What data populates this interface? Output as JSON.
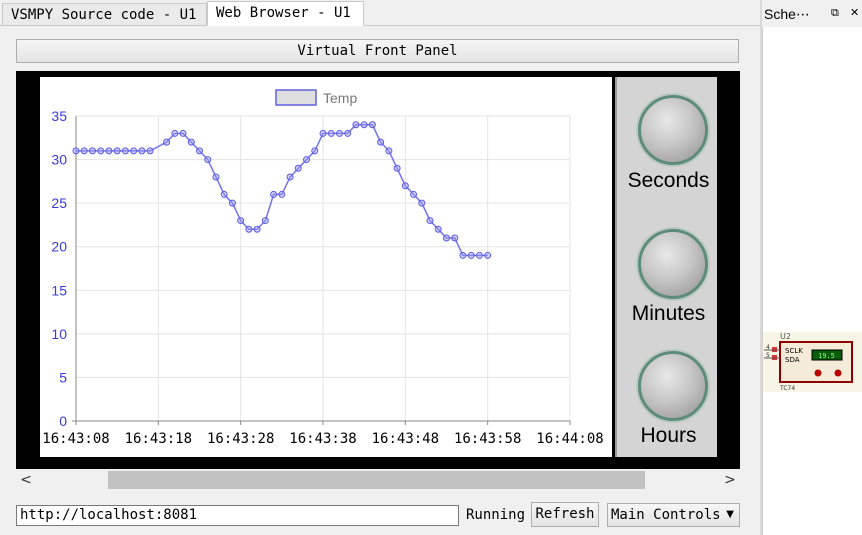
{
  "tabs": [
    {
      "label": "VSMPY Source code - U1",
      "active": false
    },
    {
      "label": "Web Browser - U1",
      "active": true
    }
  ],
  "panel_button_label": "Virtual Front Panel",
  "chart_data": {
    "type": "line",
    "legend": "Temp",
    "x": [
      "16:43:08",
      "16:43:09",
      "16:43:10",
      "16:43:11",
      "16:43:12",
      "16:43:13",
      "16:43:14",
      "16:43:15",
      "16:43:16",
      "16:43:17",
      "16:43:18",
      "16:43:19",
      "16:43:20",
      "16:43:21",
      "16:43:22",
      "16:43:23",
      "16:43:24",
      "16:43:25",
      "16:43:26",
      "16:43:27",
      "16:43:28",
      "16:43:29",
      "16:43:30",
      "16:43:31",
      "16:43:32",
      "16:43:33",
      "16:43:34",
      "16:43:35",
      "16:43:36",
      "16:43:37",
      "16:43:38",
      "16:43:39",
      "16:43:40",
      "16:43:41",
      "16:43:42",
      "16:43:43",
      "16:43:44",
      "16:43:45",
      "16:43:46",
      "16:43:47",
      "16:43:48",
      "16:43:49",
      "16:43:50",
      "16:43:51",
      "16:43:52",
      "16:43:53",
      "16:43:54",
      "16:43:55",
      "16:43:56",
      "16:43:57",
      "16:43:58",
      "16:43:59",
      "16:44:00",
      "16:44:01",
      "16:44:02",
      "16:44:03",
      "16:44:04",
      "16:44:05",
      "16:44:06",
      "16:44:07",
      "16:44:08"
    ],
    "series": [
      {
        "name": "Temp",
        "color": "#5b5be8",
        "points": [
          [
            "16:43:08",
            31
          ],
          [
            "16:43:09",
            31
          ],
          [
            "16:43:10",
            31
          ],
          [
            "16:43:11",
            31
          ],
          [
            "16:43:12",
            31
          ],
          [
            "16:43:13",
            31
          ],
          [
            "16:43:14",
            31
          ],
          [
            "16:43:15",
            31
          ],
          [
            "16:43:16",
            31
          ],
          [
            "16:43:17",
            31
          ],
          [
            "16:43:19",
            32
          ],
          [
            "16:43:20",
            33
          ],
          [
            "16:43:21",
            33
          ],
          [
            "16:43:22",
            32
          ],
          [
            "16:43:23",
            31
          ],
          [
            "16:43:24",
            30
          ],
          [
            "16:43:25",
            28
          ],
          [
            "16:43:26",
            26
          ],
          [
            "16:43:27",
            25
          ],
          [
            "16:43:28",
            23
          ],
          [
            "16:43:29",
            22
          ],
          [
            "16:43:30",
            22
          ],
          [
            "16:43:31",
            23
          ],
          [
            "16:43:32",
            26
          ],
          [
            "16:43:33",
            26
          ],
          [
            "16:43:34",
            28
          ],
          [
            "16:43:35",
            29
          ],
          [
            "16:43:36",
            30
          ],
          [
            "16:43:37",
            31
          ],
          [
            "16:43:38",
            33
          ],
          [
            "16:43:39",
            33
          ],
          [
            "16:43:40",
            33
          ],
          [
            "16:43:41",
            33
          ],
          [
            "16:43:42",
            34
          ],
          [
            "16:43:43",
            34
          ],
          [
            "16:43:44",
            34
          ],
          [
            "16:43:45",
            32
          ],
          [
            "16:43:46",
            31
          ],
          [
            "16:43:47",
            29
          ],
          [
            "16:43:48",
            27
          ],
          [
            "16:43:49",
            26
          ],
          [
            "16:43:50",
            25
          ],
          [
            "16:43:51",
            23
          ],
          [
            "16:43:52",
            22
          ],
          [
            "16:43:53",
            21
          ],
          [
            "16:43:54",
            21
          ],
          [
            "16:43:55",
            19
          ],
          [
            "16:43:56",
            19
          ],
          [
            "16:43:57",
            19
          ],
          [
            "16:43:58",
            19
          ]
        ]
      }
    ],
    "x_ticks": [
      "16:43:08",
      "16:43:18",
      "16:43:28",
      "16:43:38",
      "16:43:48",
      "16:43:58",
      "16:44:08"
    ],
    "y_ticks": [
      0,
      5,
      10,
      15,
      20,
      25,
      30,
      35
    ],
    "ylim": [
      0,
      35
    ],
    "grid": true,
    "legend_position": "top-center"
  },
  "knobs": [
    "Seconds",
    "Minutes",
    "Hours"
  ],
  "scrollbar": {
    "left_arrow": "<",
    "right_arrow": ">"
  },
  "url": "http://localhost:8081",
  "status": "Running",
  "refresh_label": "Refresh",
  "controls_select": "Main Controls",
  "side_panel": {
    "title": "Sche⋯",
    "buttons": [
      "restore-icon",
      "close-icon"
    ],
    "component": {
      "ref": "U2",
      "pins": [
        "SCLK",
        "SDA"
      ],
      "pin_numbers": [
        "4",
        "5"
      ],
      "display": "19.5",
      "part": "TC74"
    }
  }
}
